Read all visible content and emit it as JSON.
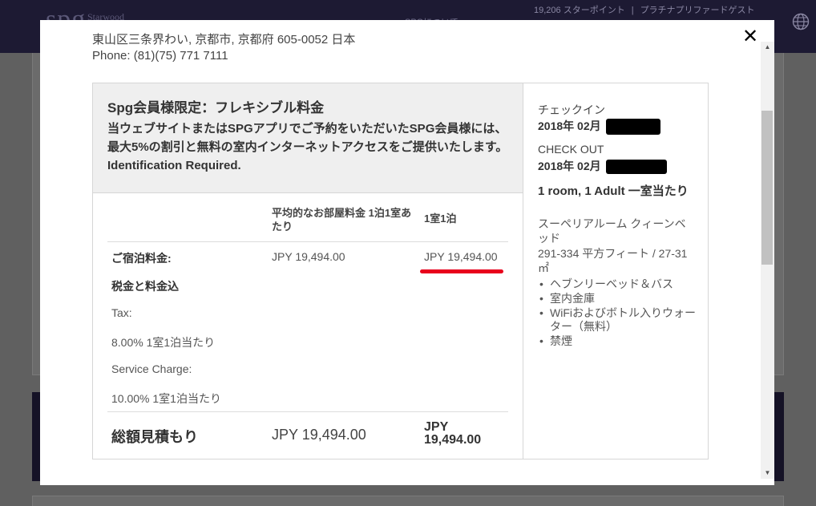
{
  "background": {
    "logo": "spg",
    "logo_sub": "Starwood",
    "points": "19,206 スターポイント",
    "tier": "プラチナプリファードゲスト",
    "nav_item": "SPGについて"
  },
  "modal": {
    "close_label": "✕",
    "address": "東山区三条界わい, 京都市, 京都府 605-0052 日本",
    "phone": "Phone: (81)(75) 771 7111"
  },
  "promo": {
    "title": "Spg会員様限定：フレキシブル料金",
    "description": "当ウェブサイトまたはSPGアプリでご予約をいただいたSPG会員様には、最大5%の割引と無料の室内インターネットアクセスをご提供いたします。Identification Required."
  },
  "table": {
    "col_avg": "平均的なお部屋料金 1泊1室あたり",
    "col_night": "1室1泊",
    "room_rate_label": "ご宿泊料金:",
    "room_rate_avg": "JPY 19,494.00",
    "room_rate_night": "JPY 19,494.00",
    "taxes_label": "税金と料金込",
    "tax_label": "Tax:",
    "tax_value": "8.00% 1室1泊当たり",
    "service_label": "Service Charge:",
    "service_value": "10.00% 1室1泊当たり",
    "total_label": "総額見積もり",
    "total_avg": "JPY 19,494.00",
    "total_night": "JPY 19,494.00"
  },
  "stay": {
    "checkin_label": "チェックイン",
    "checkin_date": "2018年 02月",
    "checkout_label": "CHECK OUT",
    "checkout_date": "2018年 02月",
    "rooms": "1 room, 1 Adult 一室当たり",
    "room_type": "スーペリアルーム クィーンベッド",
    "room_size": "291-334 平方フィート / 27-31 ㎡",
    "amenities": [
      "ヘブンリーベッド＆バス",
      "室内金庫",
      "WiFiおよびボトル入りウォーター（無料）",
      "禁煙"
    ]
  },
  "colors": {
    "header": "#1d1a33",
    "highlight": "#e8001c",
    "promo_bg": "#efefef"
  }
}
